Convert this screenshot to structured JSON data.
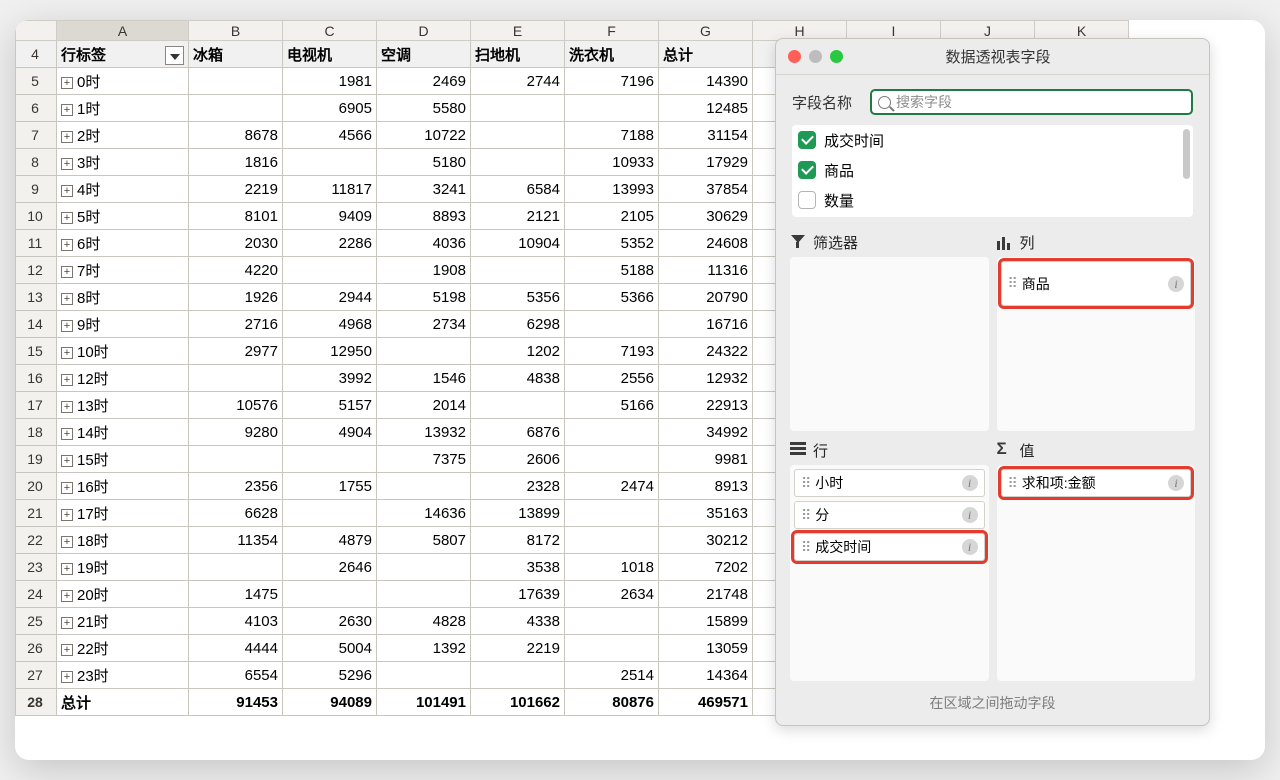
{
  "panel": {
    "title": "数据透视表字段",
    "fieldname_label": "字段名称",
    "search_placeholder": "搜索字段",
    "fields": [
      "成交时间",
      "商品",
      "数量"
    ],
    "fields_checked": [
      true,
      true,
      false
    ],
    "area_labels": {
      "filter": "筛选器",
      "columns": "列",
      "rows": "行",
      "values": "值"
    },
    "columns_items": [
      "商品"
    ],
    "rows_items": [
      "小时",
      "分",
      "成交时间"
    ],
    "values_items": [
      "求和项:金额"
    ],
    "footer": "在区域之间拖动字段"
  },
  "sheet": {
    "col_letters": [
      "A",
      "B",
      "C",
      "D",
      "E",
      "F",
      "G",
      "H",
      "I",
      "J",
      "K"
    ],
    "header_row_num": "4",
    "header_labels": [
      "行标签",
      "冰箱",
      "电视机",
      "空调",
      "扫地机",
      "洗衣机",
      "总计"
    ],
    "rows": [
      {
        "n": "5",
        "label": "0时",
        "v": [
          "",
          "1981",
          "2469",
          "2744",
          "7196",
          "14390"
        ]
      },
      {
        "n": "6",
        "label": "1时",
        "v": [
          "",
          "6905",
          "5580",
          "",
          "",
          "12485"
        ]
      },
      {
        "n": "7",
        "label": "2时",
        "v": [
          "8678",
          "4566",
          "10722",
          "",
          "7188",
          "31154"
        ]
      },
      {
        "n": "8",
        "label": "3时",
        "v": [
          "1816",
          "",
          "5180",
          "",
          "10933",
          "17929"
        ]
      },
      {
        "n": "9",
        "label": "4时",
        "v": [
          "2219",
          "11817",
          "3241",
          "6584",
          "13993",
          "37854"
        ]
      },
      {
        "n": "10",
        "label": "5时",
        "v": [
          "8101",
          "9409",
          "8893",
          "2121",
          "2105",
          "30629"
        ]
      },
      {
        "n": "11",
        "label": "6时",
        "v": [
          "2030",
          "2286",
          "4036",
          "10904",
          "5352",
          "24608"
        ]
      },
      {
        "n": "12",
        "label": "7时",
        "v": [
          "4220",
          "",
          "1908",
          "",
          "5188",
          "11316"
        ]
      },
      {
        "n": "13",
        "label": "8时",
        "v": [
          "1926",
          "2944",
          "5198",
          "5356",
          "5366",
          "20790"
        ]
      },
      {
        "n": "14",
        "label": "9时",
        "v": [
          "2716",
          "4968",
          "2734",
          "6298",
          "",
          "16716"
        ]
      },
      {
        "n": "15",
        "label": "10时",
        "v": [
          "2977",
          "12950",
          "",
          "1202",
          "7193",
          "24322"
        ]
      },
      {
        "n": "16",
        "label": "12时",
        "v": [
          "",
          "3992",
          "1546",
          "4838",
          "2556",
          "12932"
        ]
      },
      {
        "n": "17",
        "label": "13时",
        "v": [
          "10576",
          "5157",
          "2014",
          "",
          "5166",
          "22913"
        ]
      },
      {
        "n": "18",
        "label": "14时",
        "v": [
          "9280",
          "4904",
          "13932",
          "6876",
          "",
          "34992"
        ]
      },
      {
        "n": "19",
        "label": "15时",
        "v": [
          "",
          "",
          "7375",
          "2606",
          "",
          "9981"
        ]
      },
      {
        "n": "20",
        "label": "16时",
        "v": [
          "2356",
          "1755",
          "",
          "2328",
          "2474",
          "8913"
        ]
      },
      {
        "n": "21",
        "label": "17时",
        "v": [
          "6628",
          "",
          "14636",
          "13899",
          "",
          "35163"
        ]
      },
      {
        "n": "22",
        "label": "18时",
        "v": [
          "11354",
          "4879",
          "5807",
          "8172",
          "",
          "30212"
        ]
      },
      {
        "n": "23",
        "label": "19时",
        "v": [
          "",
          "2646",
          "",
          "3538",
          "1018",
          "7202"
        ]
      },
      {
        "n": "24",
        "label": "20时",
        "v": [
          "1475",
          "",
          "",
          "17639",
          "2634",
          "21748"
        ]
      },
      {
        "n": "25",
        "label": "21时",
        "v": [
          "4103",
          "2630",
          "4828",
          "4338",
          "",
          "15899"
        ]
      },
      {
        "n": "26",
        "label": "22时",
        "v": [
          "4444",
          "5004",
          "1392",
          "2219",
          "",
          "13059"
        ]
      },
      {
        "n": "27",
        "label": "23时",
        "v": [
          "6554",
          "5296",
          "",
          "",
          "2514",
          "14364"
        ]
      }
    ],
    "total": {
      "n": "28",
      "label": "总计",
      "v": [
        "91453",
        "94089",
        "101491",
        "101662",
        "80876",
        "469571"
      ]
    }
  }
}
